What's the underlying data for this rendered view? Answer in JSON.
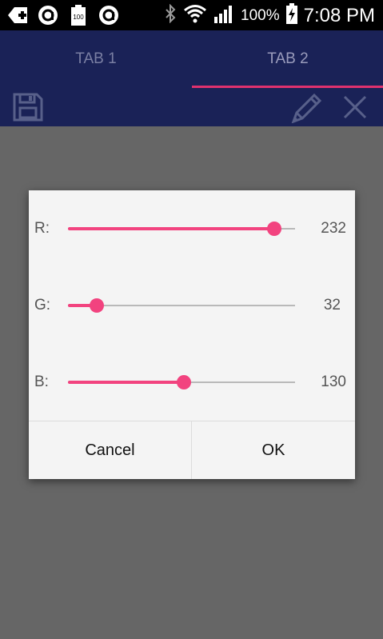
{
  "status_bar": {
    "left_icons": [
      "notification-plus-icon",
      "app-a-icon",
      "battery-100-icon",
      "app-a-icon"
    ],
    "battery_percent": "100%",
    "time": "7:08 PM"
  },
  "tabs": [
    {
      "label": "TAB 1",
      "selected": false
    },
    {
      "label": "TAB 2",
      "selected": true
    }
  ],
  "toolbar": {
    "icons": [
      "save-icon",
      "edit-icon",
      "close-icon"
    ]
  },
  "dialog": {
    "sliders": [
      {
        "label": "R:",
        "value": "232",
        "max": 255
      },
      {
        "label": "G:",
        "value": "32",
        "max": 255
      },
      {
        "label": "B:",
        "value": "130",
        "max": 255
      }
    ],
    "cancel_label": "Cancel",
    "ok_label": "OK"
  },
  "colors": {
    "app_bar": "#1a2257",
    "accent": "#f2437f",
    "tab_indicator": "#e0316e",
    "scrim": "#666666"
  }
}
